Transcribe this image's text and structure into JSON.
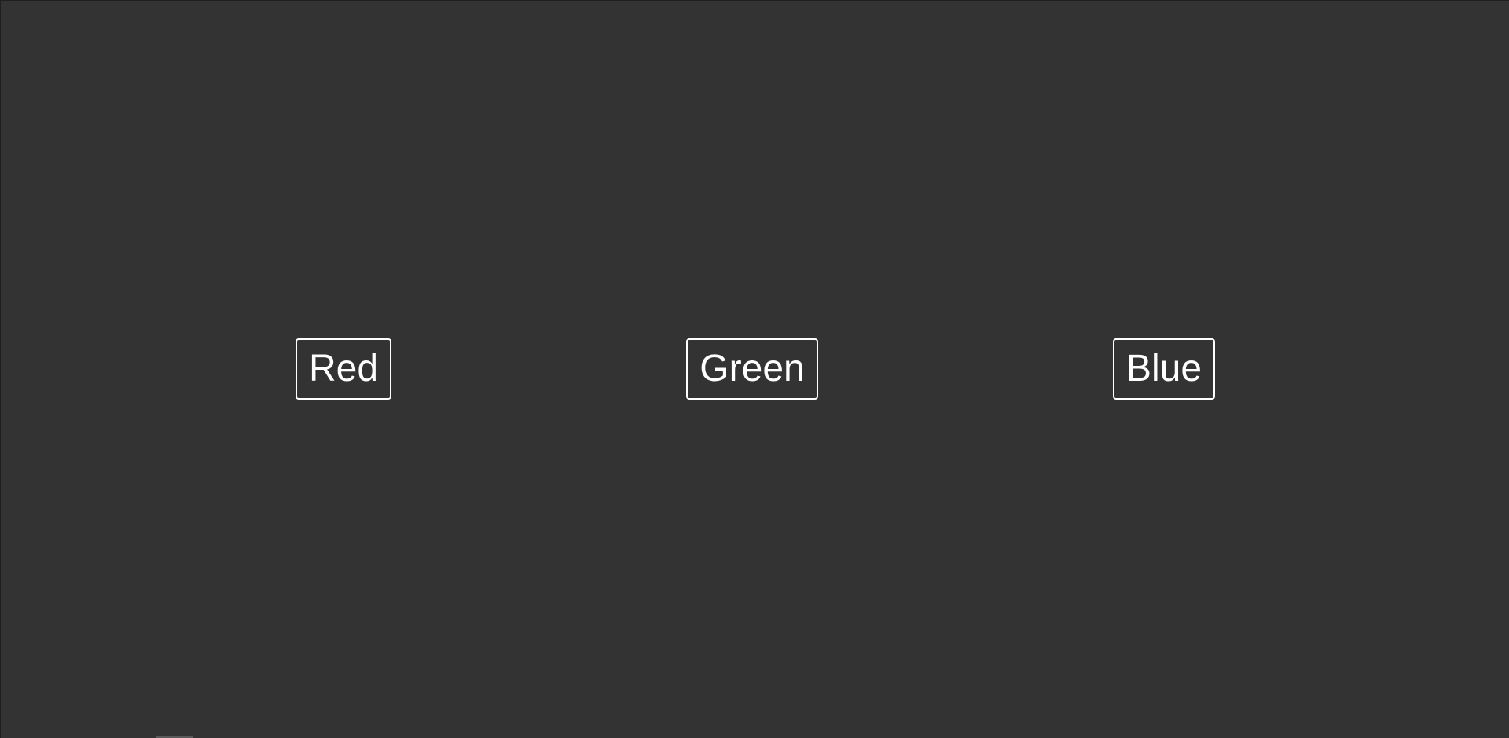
{
  "buttons": {
    "red": {
      "label": "Red"
    },
    "green": {
      "label": "Green"
    },
    "blue": {
      "label": "Blue"
    }
  },
  "colors": {
    "background": "#333333",
    "button_border": "#ffffff",
    "button_text": "#ffffff"
  }
}
